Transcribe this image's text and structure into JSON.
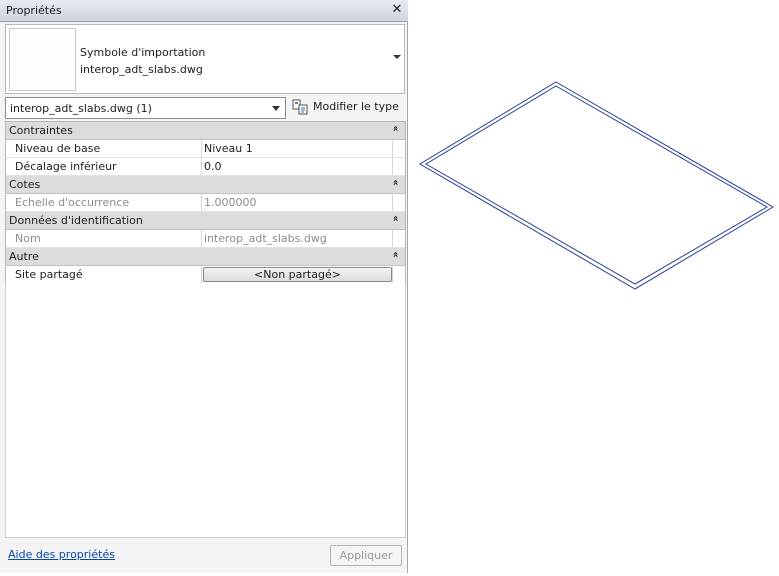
{
  "palette": {
    "title": "Propriétés",
    "close_glyph": "✕",
    "type_selector": {
      "line1": "Symbole d'importation",
      "line2": "interop_adt_slabs.dwg"
    },
    "instance_filter": "interop_adt_slabs.dwg (1)",
    "edit_type_label": "Modifier le type",
    "groups": [
      {
        "label": "Contraintes",
        "rows": [
          {
            "name": "Niveau de base",
            "value": "Niveau 1"
          },
          {
            "name": "Décalage inférieur",
            "value": "0.0"
          }
        ]
      },
      {
        "label": "Cotes",
        "rows": [
          {
            "name": "Echelle d'occurrence",
            "value": "1.000000"
          }
        ]
      },
      {
        "label": "Données d'identification",
        "rows": [
          {
            "name": "Nom",
            "value": "interop_adt_slabs.dwg"
          }
        ]
      },
      {
        "label": "Autre",
        "rows": [
          {
            "name": "Site partagé",
            "value": "<Non partagé>"
          }
        ]
      }
    ],
    "collapse_glyph": "»",
    "help_link": "Aide des propriétés",
    "apply_button": "Appliquer"
  },
  "colors": {
    "slab_outline": "#2a3f9a",
    "group_header": "#dcdcdc",
    "link": "#0645ad"
  }
}
